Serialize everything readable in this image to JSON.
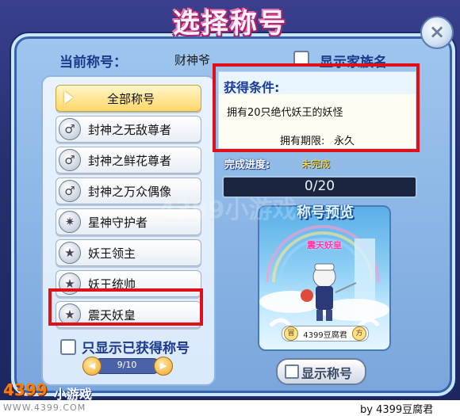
{
  "window": {
    "title": "选择称号",
    "close_icon": "×"
  },
  "current": {
    "label": "当前称号：",
    "value": "财神爷"
  },
  "family": {
    "label": "显示家族名"
  },
  "titles": {
    "all_label": "全部称号",
    "items": [
      {
        "label": "封神之无敌尊者",
        "icon": "fengshen-badge-icon",
        "glyph": "♂"
      },
      {
        "label": "封神之鲜花尊者",
        "icon": "fengshen-badge-icon",
        "glyph": "♂"
      },
      {
        "label": "封神之万众偶像",
        "icon": "fengshen-badge-icon",
        "glyph": "♂"
      },
      {
        "label": "星神守护者",
        "icon": "star-guardian-icon",
        "glyph": "✷"
      },
      {
        "label": "妖王领主",
        "icon": "star-badge-icon",
        "glyph": "★"
      },
      {
        "label": "妖王统帅",
        "icon": "star-badge-icon",
        "glyph": "★"
      },
      {
        "label": "震天妖皇",
        "icon": "star-badge-icon",
        "glyph": "★"
      }
    ]
  },
  "filter": {
    "only_owned_label": "只显示已获得称号"
  },
  "pager": {
    "text": "9/10",
    "prev_glyph": "◀",
    "next_glyph": "▶"
  },
  "condition": {
    "title": "获得条件:",
    "text": "拥有20只绝代妖王的妖怪",
    "period_label": "拥有期限:",
    "period_value": "永久"
  },
  "progress": {
    "label": "完成进度:",
    "status": "未完成",
    "text": "0/20",
    "fraction": 0
  },
  "preview": {
    "title": "称号预览",
    "title_name": "震天妖皇",
    "nameplate": "4399豆腐君",
    "nameplate_left": "冒",
    "nameplate_right": "方"
  },
  "show_title_button": {
    "label": "显示称号"
  },
  "branding": {
    "logo": "4399",
    "logo_suffix": "小游戏",
    "url": "WWW.4399.COM",
    "watermark": "4399小游戏",
    "credit": "by 4399豆腐君"
  },
  "colors": {
    "highlight_border": "#e0101a",
    "panel_title": "#1c3a8e",
    "progress_status": "#ffe04a"
  }
}
